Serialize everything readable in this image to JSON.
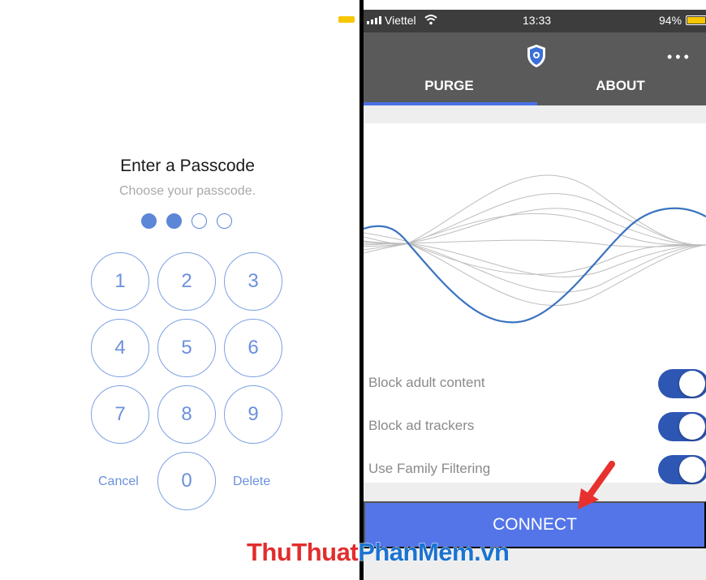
{
  "passcode": {
    "title": "Enter a Passcode",
    "subtitle": "Choose your passcode.",
    "dots_filled": 2,
    "dots_total": 4,
    "keys": [
      "1",
      "2",
      "3",
      "4",
      "5",
      "6",
      "7",
      "8",
      "9",
      "0"
    ],
    "cancel_label": "Cancel",
    "delete_label": "Delete"
  },
  "status": {
    "carrier": "Viettel",
    "time": "13:33",
    "battery": "94%"
  },
  "app": {
    "more_label": "•••",
    "tabs": [
      "PURGE",
      "ABOUT"
    ],
    "active_tab": "PURGE",
    "options": [
      {
        "label": "Block adult content",
        "enabled": true
      },
      {
        "label": "Block ad trackers",
        "enabled": true
      },
      {
        "label": "Use Family Filtering",
        "enabled": true
      }
    ],
    "connect_label": "CONNECT"
  },
  "watermark": {
    "part1": "ThuThuat",
    "part2": "PhanMem.vn"
  },
  "colors": {
    "accent": "#5475e8",
    "toggle": "#2e56b3",
    "header": "#5a5a5a",
    "key": "#6b91dc",
    "arrow": "#e8312f"
  }
}
